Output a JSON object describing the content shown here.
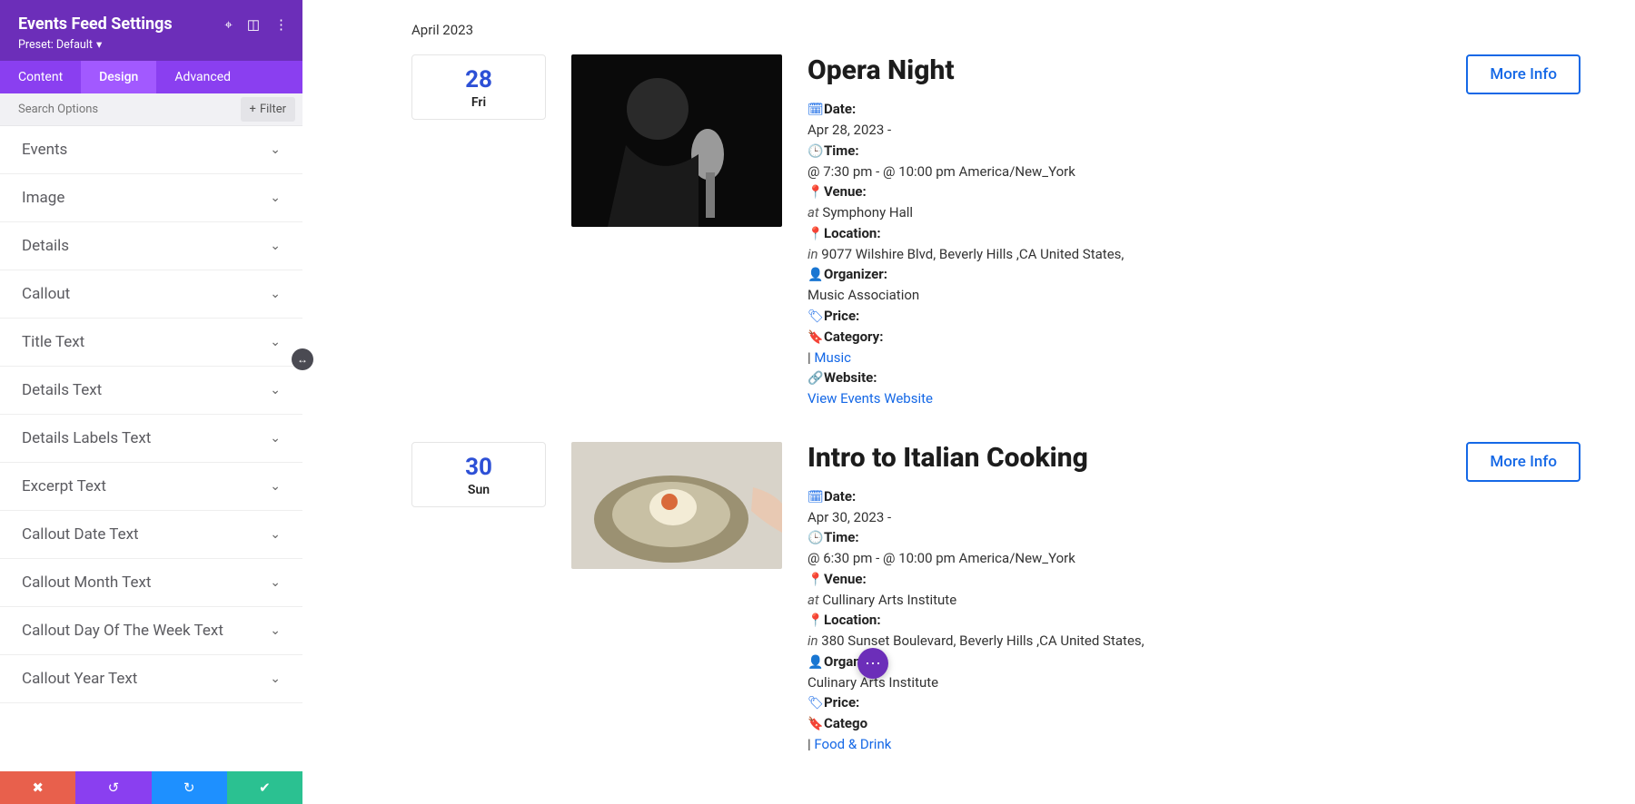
{
  "sidebar": {
    "title": "Events Feed Settings",
    "preset_label": "Preset: Default",
    "tabs": {
      "content": "Content",
      "design": "Design",
      "advanced": "Advanced"
    },
    "search_placeholder": "Search Options",
    "filter_label": "Filter",
    "sections": [
      "Events",
      "Image",
      "Details",
      "Callout",
      "Title Text",
      "Details Text",
      "Details Labels Text",
      "Excerpt Text",
      "Callout Date Text",
      "Callout Month Text",
      "Callout Day Of The Week Text",
      "Callout Year Text"
    ]
  },
  "main": {
    "month": "April 2023",
    "more_label": "More Info",
    "events": [
      {
        "day_num": "28",
        "day_name": "Fri",
        "title": "Opera Night",
        "date_label": "Date:",
        "date_value": "Apr 28, 2023 -",
        "time_label": "Time:",
        "time_value": "@ 7:30 pm - @ 10:00 pm America/New_York",
        "venue_label": "Venue:",
        "venue_prefix": "at",
        "venue_value": "Symphony Hall",
        "location_label": "Location:",
        "location_prefix": "in",
        "location_value": "9077 Wilshire Blvd, Beverly Hills ,CA United States,",
        "organizer_label": "Organizer:",
        "organizer_value": "Music Association",
        "price_label": "Price:",
        "category_label": "Category:",
        "category_sep": "|",
        "category_link": "Music",
        "website_label": "Website:",
        "website_link": "View Events Website"
      },
      {
        "day_num": "30",
        "day_name": "Sun",
        "title": "Intro to Italian Cooking",
        "date_label": "Date:",
        "date_value": "Apr 30, 2023 -",
        "time_label": "Time:",
        "time_value": "@ 6:30 pm - @ 10:00 pm America/New_York",
        "venue_label": "Venue:",
        "venue_prefix": "at",
        "venue_value": "Cullinary Arts Institute",
        "location_label": "Location:",
        "location_prefix": "in",
        "location_value": "380 Sunset Boulevard, Beverly Hills ,CA United States,",
        "organizer_label": "Organizer:",
        "organizer_value": "Culinary Arts Institute",
        "price_label": "Price:",
        "category_label": "Catego",
        "category_sep": "|",
        "category_link": "Food & Drink"
      }
    ]
  }
}
